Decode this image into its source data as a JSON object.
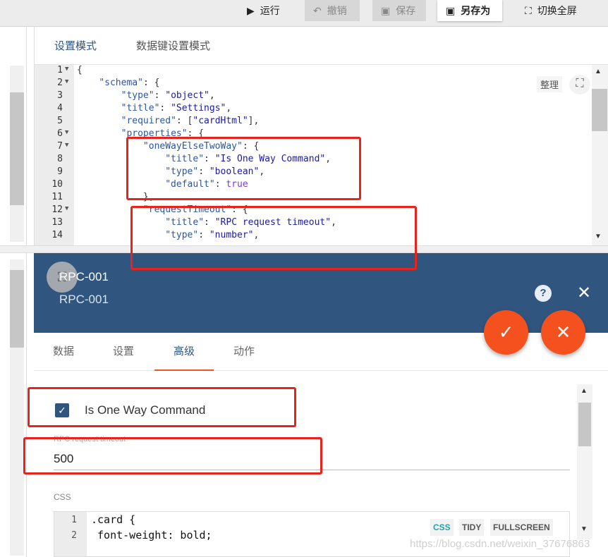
{
  "toolbar": {
    "run": "运行",
    "undo": "撤销",
    "save": "保存",
    "save_as": "另存为",
    "fullscreen": "切换全屏"
  },
  "editor": {
    "tabs": [
      "设置模式",
      "数据键设置模式"
    ],
    "tidy": "整理",
    "lines": [
      {
        "n": "1",
        "fold": true,
        "text": "{"
      },
      {
        "n": "2",
        "fold": true,
        "text": "    \"schema\": {"
      },
      {
        "n": "3",
        "fold": false,
        "text": "        \"type\": \"object\","
      },
      {
        "n": "4",
        "fold": false,
        "text": "        \"title\": \"Settings\","
      },
      {
        "n": "5",
        "fold": false,
        "text": "        \"required\": [\"cardHtml\"],"
      },
      {
        "n": "6",
        "fold": true,
        "text": "        \"properties\": {"
      },
      {
        "n": "7",
        "fold": true,
        "text": "            \"oneWayElseTwoWay\": {"
      },
      {
        "n": "8",
        "fold": false,
        "text": "                \"title\": \"Is One Way Command\","
      },
      {
        "n": "9",
        "fold": false,
        "text": "                \"type\": \"boolean\","
      },
      {
        "n": "10",
        "fold": false,
        "text": "                \"default\": true"
      },
      {
        "n": "11",
        "fold": false,
        "text": "            },"
      },
      {
        "n": "12",
        "fold": true,
        "text": "            \"requestTimeout\": {"
      },
      {
        "n": "13",
        "fold": false,
        "text": "                \"title\": \"RPC request timeout\","
      },
      {
        "n": "14",
        "fold": false,
        "text": "                \"type\": \"number\","
      }
    ]
  },
  "dialog": {
    "title": "RPC-001",
    "subtitle": "RPC-001",
    "tabs": [
      "数据",
      "设置",
      "高级",
      "动作"
    ],
    "checkbox_label": "Is One Way Command",
    "timeout_label": "RPC request timeout",
    "timeout_value": "500",
    "css_label": "CSS",
    "css_lines": [
      {
        "n": "1",
        "text": ".card {"
      },
      {
        "n": "2",
        "text": " font-weight: bold;"
      }
    ],
    "chips": [
      "CSS",
      "TIDY",
      "FULLSCREEN"
    ]
  },
  "watermark": "https://blog.csdn.net/weixin_37676863",
  "colors": {
    "accent": "#305680",
    "fab": "#f4511e",
    "highlight": "#e8231c"
  }
}
